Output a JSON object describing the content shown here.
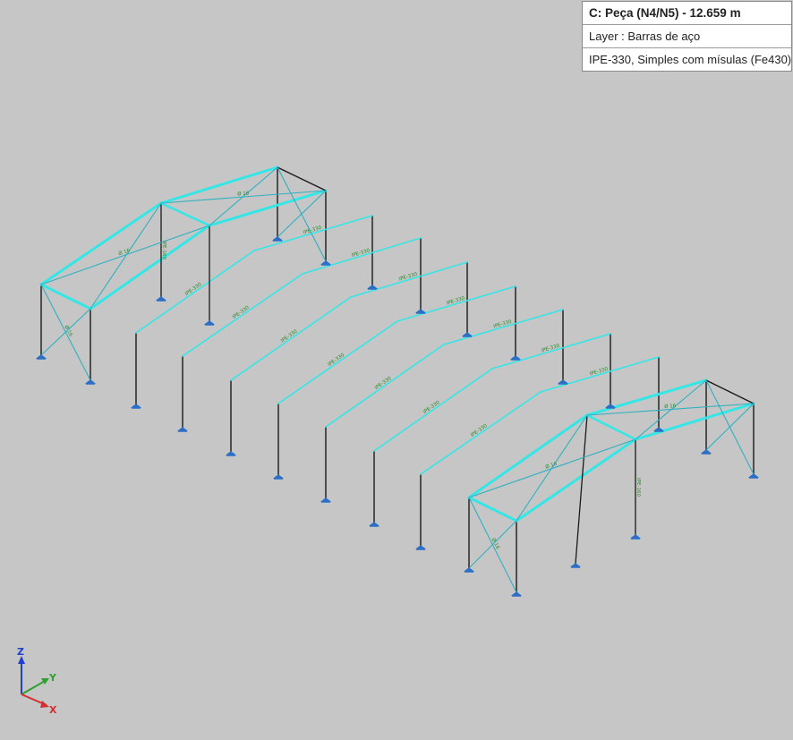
{
  "info_panel": {
    "title": "C: Peça (N4/N5) - 12.659 m",
    "layer": "Layer : Barras de aço",
    "profile": "IPE-330, Simples com mísulas (Fe430)"
  },
  "frame_labels": {
    "rafter": "IPE-330",
    "brace": "Ø 16",
    "strut": "IPE-160"
  },
  "axes": {
    "z": "Z",
    "y": "Y",
    "x": "X"
  },
  "colors": {
    "background": "#c6c6c6",
    "selected_member": "#35e6e6",
    "bracing": "#2fb0c0",
    "column": "#1a1a1a",
    "label": "#2a8a2a",
    "support": "#2c6fc7",
    "axis_x": "#d03030",
    "axis_y": "#30a030",
    "axis_z": "#2040d0"
  }
}
